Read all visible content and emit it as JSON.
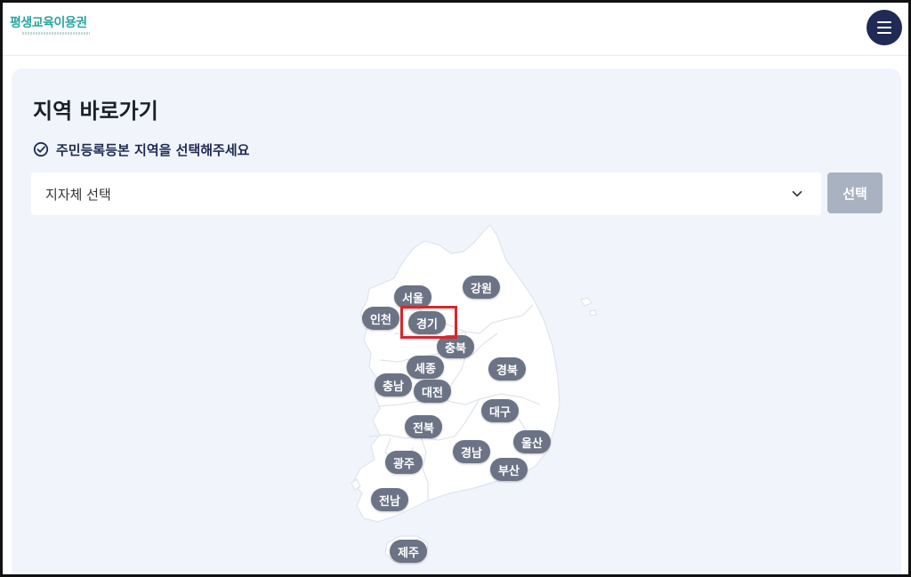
{
  "header": {
    "logo_text": "평생교육이용권",
    "menu_icon": "hamburger-icon"
  },
  "main": {
    "title": "지역 바로가기",
    "subtitle": "주민등록등본 지역을 선택해주세요",
    "subtitle_icon": "check-circle-icon",
    "select": {
      "selected_value": "지자체 선택",
      "icon": "chevron-down-icon"
    },
    "select_button": "선택"
  },
  "map": {
    "regions": [
      {
        "key": "seoul",
        "label": "서울"
      },
      {
        "key": "gangwon",
        "label": "강원"
      },
      {
        "key": "incheon",
        "label": "인천"
      },
      {
        "key": "gyeonggi",
        "label": "경기",
        "highlighted": true
      },
      {
        "key": "chungbuk",
        "label": "충북"
      },
      {
        "key": "sejong",
        "label": "세종"
      },
      {
        "key": "gyeongbuk",
        "label": "경북"
      },
      {
        "key": "chungnam",
        "label": "충남"
      },
      {
        "key": "daejeon",
        "label": "대전"
      },
      {
        "key": "daegu",
        "label": "대구"
      },
      {
        "key": "jeonbuk",
        "label": "전북"
      },
      {
        "key": "ulsan",
        "label": "울산"
      },
      {
        "key": "gyeongnam",
        "label": "경남"
      },
      {
        "key": "gwangju",
        "label": "광주"
      },
      {
        "key": "busan",
        "label": "부산"
      },
      {
        "key": "jeonnam",
        "label": "전남"
      },
      {
        "key": "jeju",
        "label": "제주"
      }
    ],
    "highlight_color": "#d8262c"
  },
  "colors": {
    "brand": "#2aa6a0",
    "navy": "#1f2a55",
    "panel_bg": "#f1f5fb",
    "region_pill": "#6b7385",
    "button_disabled": "#a9b2c0"
  }
}
